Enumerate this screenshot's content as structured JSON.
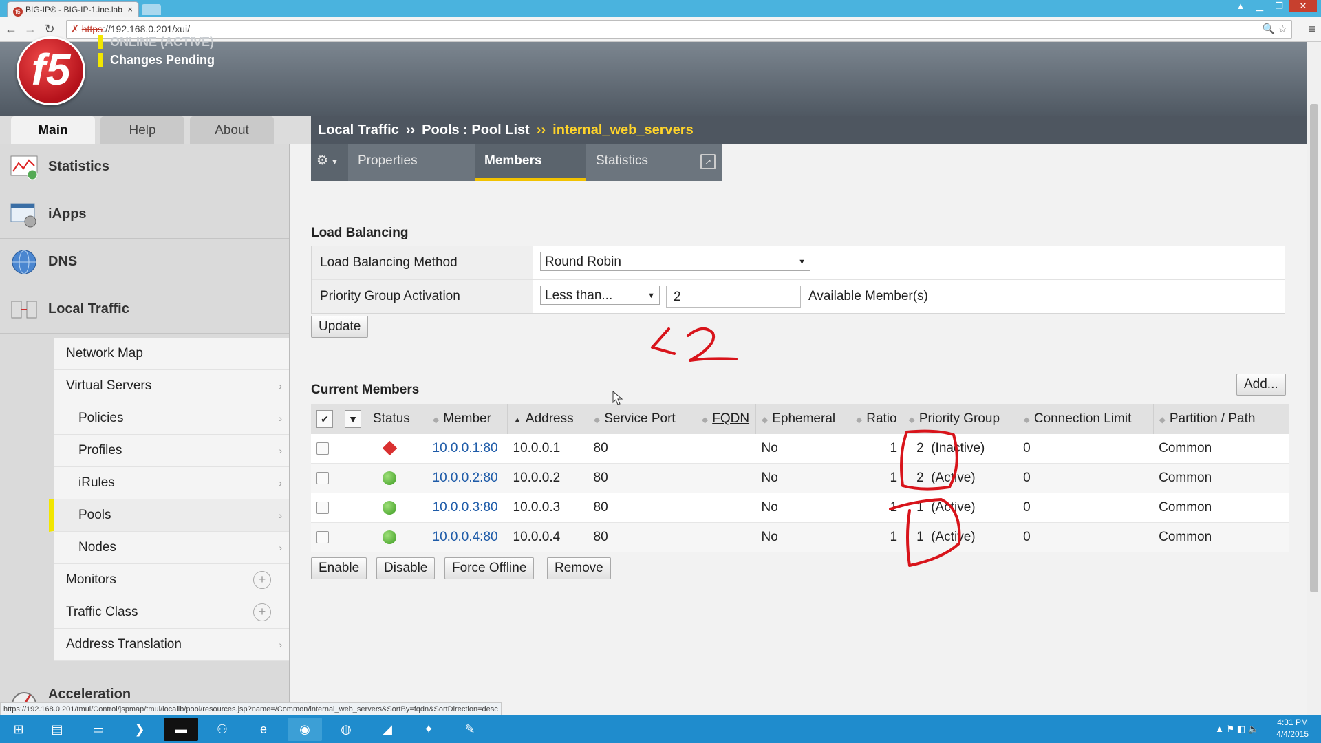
{
  "browser": {
    "tab_title": "BIG-IP® - BIG-IP-1.ine.lab",
    "url": "https://192.168.0.201/xui/",
    "url_prefix": "https",
    "url_rest": "://192.168.0.201/xui/",
    "status_url": "https://192.168.0.201/tmui/Control/jspmap/tmui/locallb/pool/resources.jsp?name=/Common/internal_web_servers&SortBy=fqdn&SortDirection=desc"
  },
  "header": {
    "logo_text": "f5",
    "status_top": "ONLINE (ACTIVE)",
    "status_pending": "Changes Pending"
  },
  "main_tabs": [
    "Main",
    "Help",
    "About"
  ],
  "sidebar": {
    "sections": [
      "Statistics",
      "iApps",
      "DNS",
      "Local Traffic",
      "Acceleration"
    ],
    "items": [
      {
        "label": "Network Map"
      },
      {
        "label": "Virtual Servers"
      },
      {
        "label": "Policies"
      },
      {
        "label": "Profiles"
      },
      {
        "label": "iRules"
      },
      {
        "label": "Pools"
      },
      {
        "label": "Nodes"
      },
      {
        "label": "Monitors"
      },
      {
        "label": "Traffic Class"
      },
      {
        "label": "Address Translation"
      }
    ]
  },
  "breadcrumb": {
    "part1": "Local Traffic",
    "sep": "››",
    "part2": "Pools : Pool List",
    "current": "internal_web_servers"
  },
  "subtabs": [
    "Properties",
    "Members",
    "Statistics"
  ],
  "load_balancing": {
    "title": "Load Balancing",
    "method_label": "Load Balancing Method",
    "method_value": "Round Robin",
    "pga_label": "Priority Group Activation",
    "pga_value": "Less than...",
    "pga_count": "2",
    "pga_suffix": "Available Member(s)",
    "update_label": "Update"
  },
  "members": {
    "title": "Current Members",
    "add_label": "Add...",
    "columns": [
      "Status",
      "Member",
      "Address",
      "Service Port",
      "FQDN",
      "Ephemeral",
      "Ratio",
      "Priority Group",
      "Connection Limit",
      "Partition / Path"
    ],
    "rows": [
      {
        "member": "10.0.0.1:80",
        "address": "10.0.0.1",
        "port": "80",
        "fqdn": "",
        "ephemeral": "No",
        "ratio": "1",
        "priority": "2  (Inactive)",
        "conn_limit": "0",
        "partition": "Common"
      },
      {
        "member": "10.0.0.2:80",
        "address": "10.0.0.2",
        "port": "80",
        "fqdn": "",
        "ephemeral": "No",
        "ratio": "1",
        "priority": "2  (Active)",
        "conn_limit": "0",
        "partition": "Common"
      },
      {
        "member": "10.0.0.3:80",
        "address": "10.0.0.3",
        "port": "80",
        "fqdn": "",
        "ephemeral": "No",
        "ratio": "1",
        "priority": "1  (Active)",
        "conn_limit": "0",
        "partition": "Common"
      },
      {
        "member": "10.0.0.4:80",
        "address": "10.0.0.4",
        "port": "80",
        "fqdn": "",
        "ephemeral": "No",
        "ratio": "1",
        "priority": "1  (Active)",
        "conn_limit": "0",
        "partition": "Common"
      }
    ],
    "actions": [
      "Enable",
      "Disable",
      "Force Offline",
      "Remove"
    ]
  },
  "annotation_text": "<2",
  "taskbar": {
    "time": "4:31 PM",
    "date": "4/4/2015"
  },
  "colors": {
    "accent_yellow": "#f2e600",
    "breadcrumb_current": "#ffd42a",
    "link": "#1e5ba8",
    "status_up": "#3a9a1f",
    "status_down": "#d93030",
    "annotation": "#d8141b"
  }
}
